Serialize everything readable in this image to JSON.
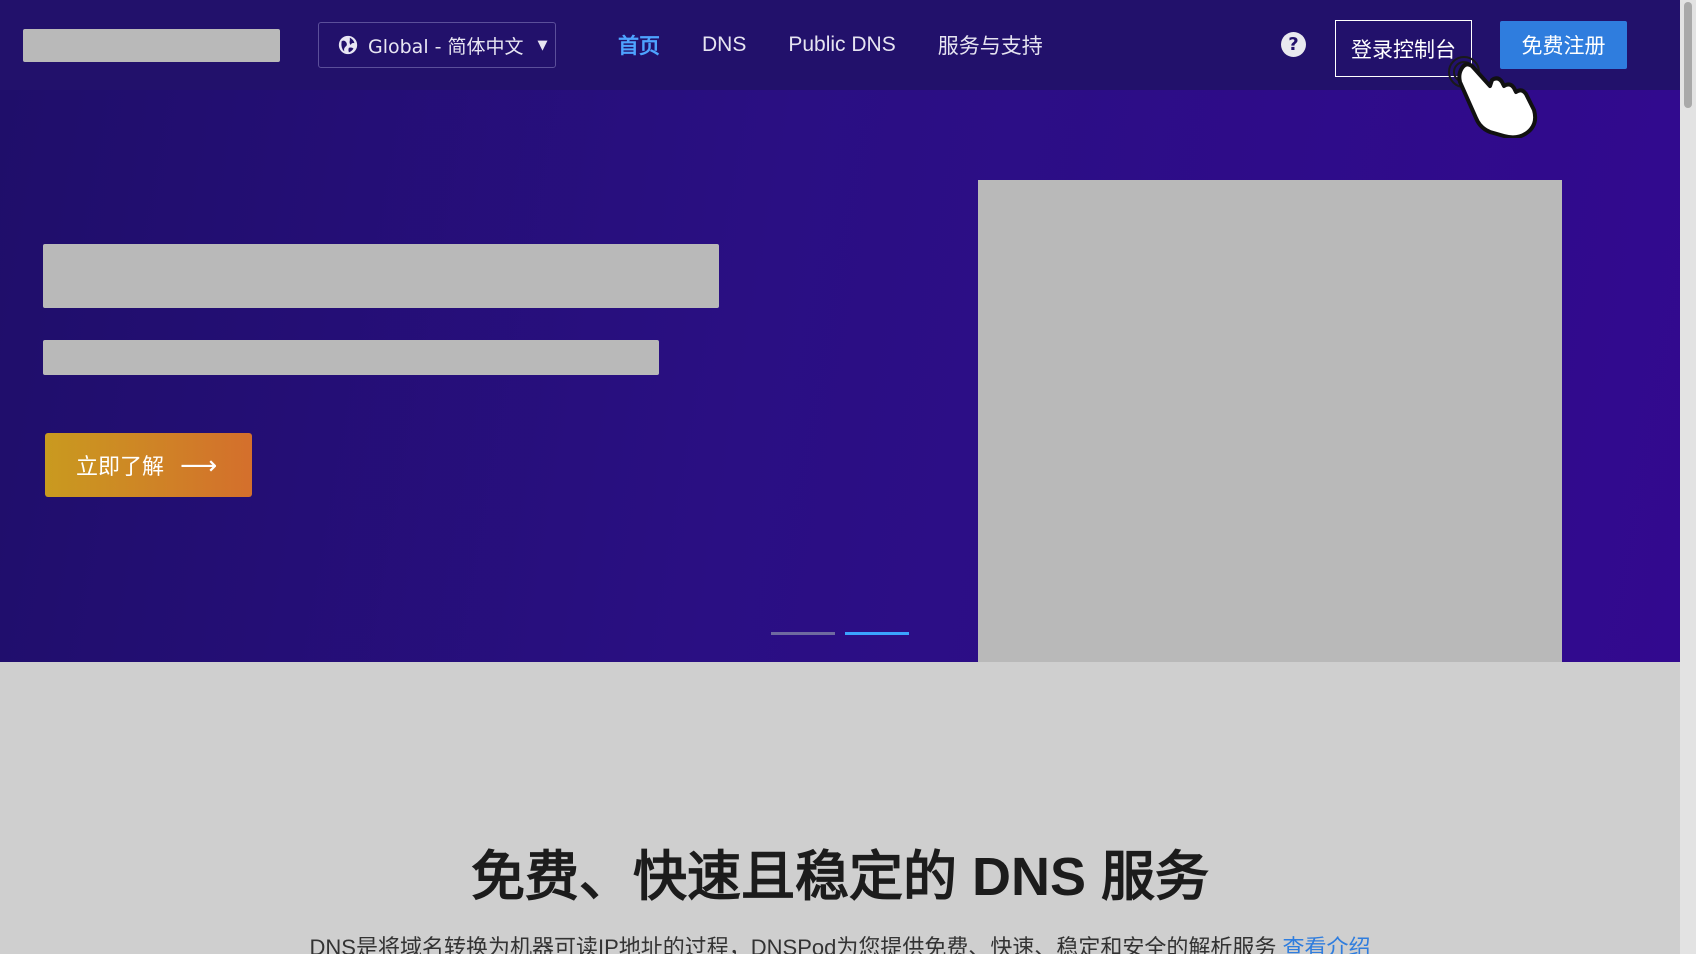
{
  "header": {
    "language_selector": "Global - 简体中文",
    "nav": [
      {
        "label": "首页",
        "active": true
      },
      {
        "label": "DNS",
        "active": false
      },
      {
        "label": "Public DNS",
        "active": false
      },
      {
        "label": "服务与支持",
        "active": false
      }
    ],
    "help_icon": "?",
    "login_label": "登录控制台",
    "register_label": "免费注册"
  },
  "hero": {
    "cta_label": "立即了解",
    "cta_arrow": "⟶",
    "carousel": {
      "count": 2,
      "active_index": 1
    }
  },
  "section": {
    "title": "免费、快速且稳定的 DNS 服务",
    "description": "DNS是将域名转换为机器可读IP地址的过程，DNSPod为您提供免费、快速、稳定和安全的解析服务 ",
    "link": "查看介绍"
  },
  "colors": {
    "header_bg": "#22116b",
    "accent_blue": "#2f7dde",
    "active_nav": "#4ea3ff",
    "cta_gradient_start": "#c99a1f",
    "cta_gradient_end": "#d46f2c"
  },
  "icons": [
    "globe-icon",
    "caret-down-icon",
    "help-icon",
    "arrow-right-icon",
    "hand-cursor-icon"
  ]
}
